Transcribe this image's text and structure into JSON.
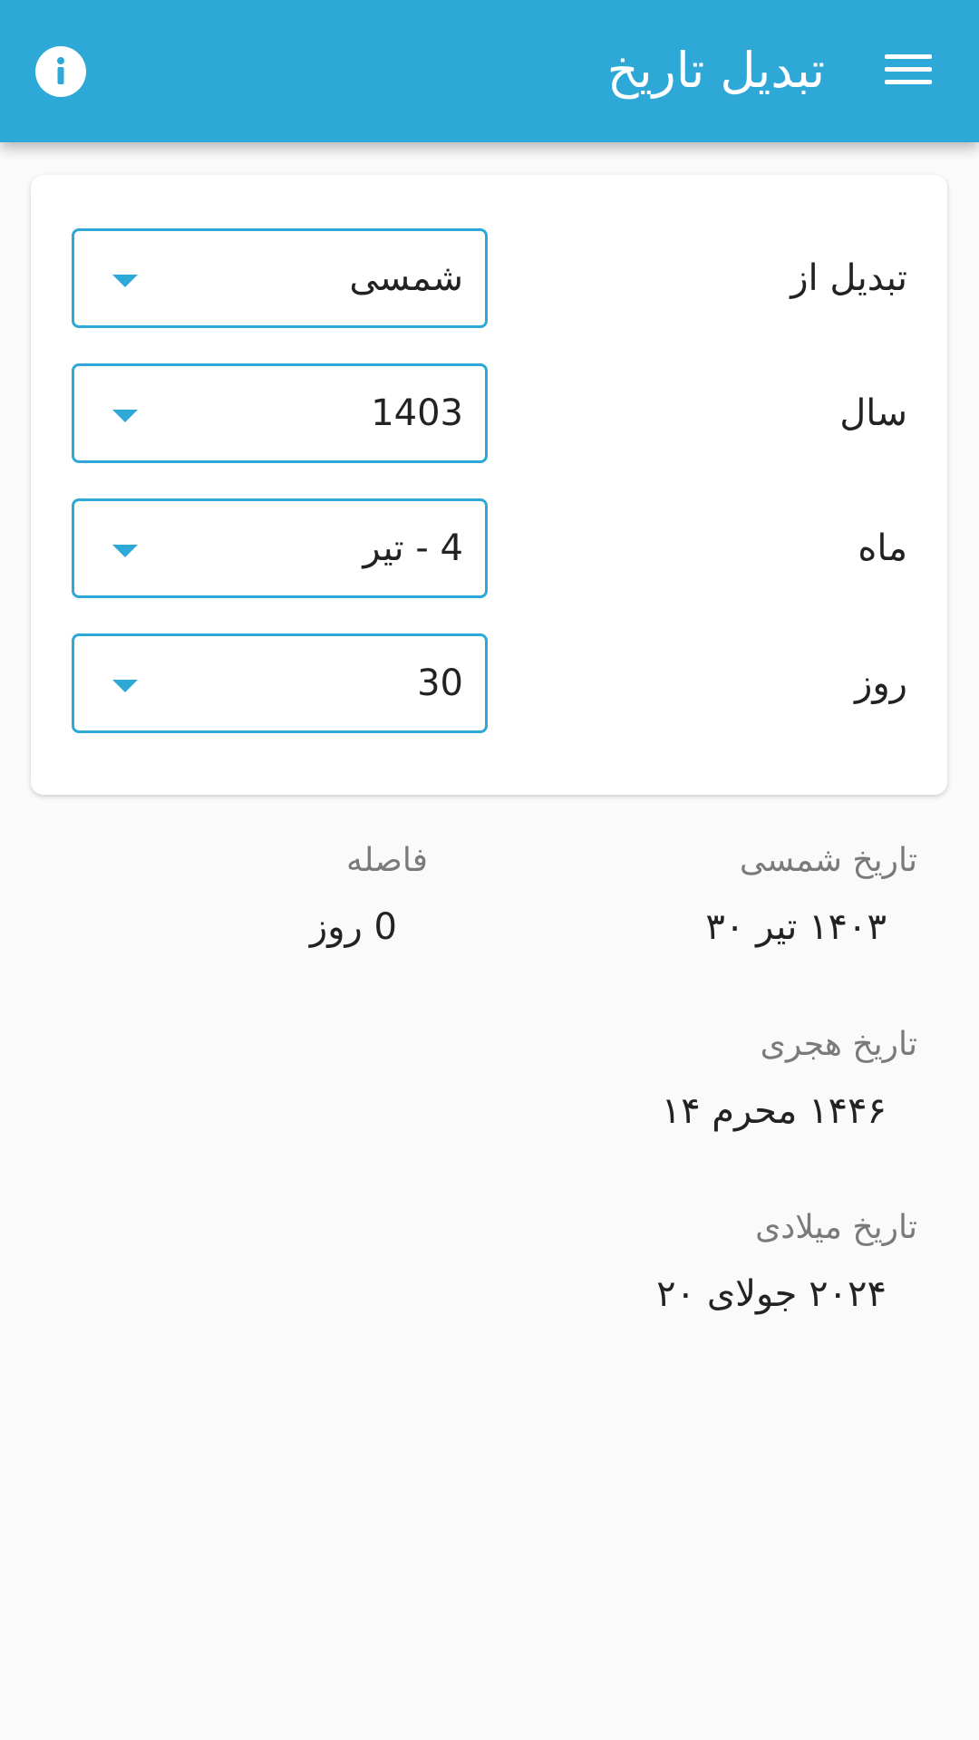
{
  "header": {
    "title": "تبدیل تاریخ",
    "menu_icon": "hamburger-menu-icon",
    "info_icon": "info-icon",
    "background_color": "#2ea8d6"
  },
  "form": {
    "convert_from": {
      "label": "تبدیل از",
      "value": "شمسی"
    },
    "year": {
      "label": "سال",
      "value": "1403"
    },
    "month": {
      "label": "ماه",
      "value": "4 - تیر"
    },
    "day": {
      "label": "روز",
      "value": "30"
    }
  },
  "results": {
    "shamsi": {
      "label": "تاریخ شمسی",
      "value": "۱۴۰۳ تیر ۳۰"
    },
    "gap": {
      "label": "فاصله",
      "value": "0 روز"
    },
    "hijri": {
      "label": "تاریخ هجری",
      "value": "۱۴۴۶ محرم ۱۴"
    },
    "gregorian": {
      "label": "تاریخ میلادی",
      "value": "۲۰۲۴ جولای ۲۰"
    }
  },
  "colors": {
    "accent": "#2ea8d6",
    "page_background": "#fafafa",
    "muted_text": "#7a7a7a"
  }
}
